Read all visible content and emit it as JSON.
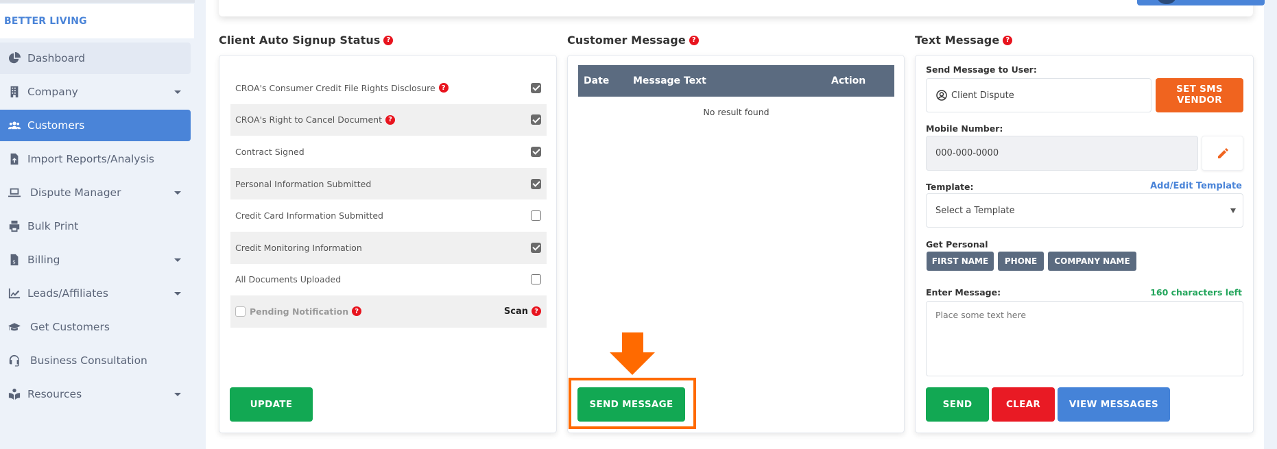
{
  "brand": "BETTER LIVING",
  "sidebar": {
    "items": [
      {
        "label": "Dashboard",
        "icon": "pie-chart-icon",
        "caret": false
      },
      {
        "label": "Company",
        "icon": "building-icon",
        "caret": true
      },
      {
        "label": "Customers",
        "icon": "users-icon",
        "caret": false,
        "active": true
      },
      {
        "label": "Import Reports/Analysis",
        "icon": "file-upload-icon",
        "caret": false
      },
      {
        "label": "Dispute Manager",
        "icon": "laptop-icon",
        "caret": true
      },
      {
        "label": "Bulk Print",
        "icon": "printer-icon",
        "caret": false
      },
      {
        "label": "Billing",
        "icon": "invoice-icon",
        "caret": true
      },
      {
        "label": "Leads/Affiliates",
        "icon": "chart-line-icon",
        "caret": true
      },
      {
        "label": "Get Customers",
        "icon": "graduation-cap-icon",
        "caret": false
      },
      {
        "label": "Business Consultation",
        "icon": "headset-icon",
        "caret": false
      },
      {
        "label": "Resources",
        "icon": "reader-icon",
        "caret": true
      }
    ]
  },
  "signup": {
    "title": "Client Auto Signup Status",
    "rows": [
      {
        "label": "CROA's Consumer Credit File Rights Disclosure",
        "help": true,
        "checked": true
      },
      {
        "label": "CROA's Right to Cancel Document",
        "help": true,
        "checked": true
      },
      {
        "label": "Contract Signed",
        "help": false,
        "checked": true
      },
      {
        "label": "Personal Information Submitted",
        "help": false,
        "checked": true
      },
      {
        "label": "Credit Card Information Submitted",
        "help": false,
        "checked": false
      },
      {
        "label": "Credit Monitoring Information",
        "help": false,
        "checked": true
      },
      {
        "label": "All Documents Uploaded",
        "help": false,
        "checked": false
      }
    ],
    "pending": {
      "label": "Pending Notification",
      "checked": false,
      "scan_label": "Scan"
    },
    "update_label": "UPDATE"
  },
  "customer_message": {
    "title": "Customer Message",
    "columns": [
      "Date",
      "Message Text",
      "Action"
    ],
    "empty_text": "No result found",
    "send_label": "SEND MESSAGE"
  },
  "text_message": {
    "title": "Text Message",
    "send_to_label": "Send Message to User:",
    "send_to_value": "Client Dispute",
    "set_sms_vendor_label": "SET SMS VENDOR",
    "mobile_label": "Mobile Number:",
    "mobile_value": "000-000-0000",
    "template_label": "Template:",
    "add_edit_template": "Add/Edit Template",
    "template_placeholder": "Select a Template",
    "get_personal_label": "Get Personal",
    "personal_tags": [
      "FIRST NAME",
      "PHONE",
      "COMPANY NAME"
    ],
    "enter_message_label": "Enter Message:",
    "chars_left": "160 characters left",
    "message_placeholder": "Place some text here",
    "send_label": "SEND",
    "clear_label": "CLEAR",
    "view_messages_label": "VIEW MESSAGES"
  },
  "colors": {
    "primary_blue": "#4a84d8",
    "green": "#12a853",
    "red": "#e91a24",
    "orange": "#f0641f",
    "annotation_orange": "#ff6a00",
    "table_header": "#5b6b80"
  }
}
